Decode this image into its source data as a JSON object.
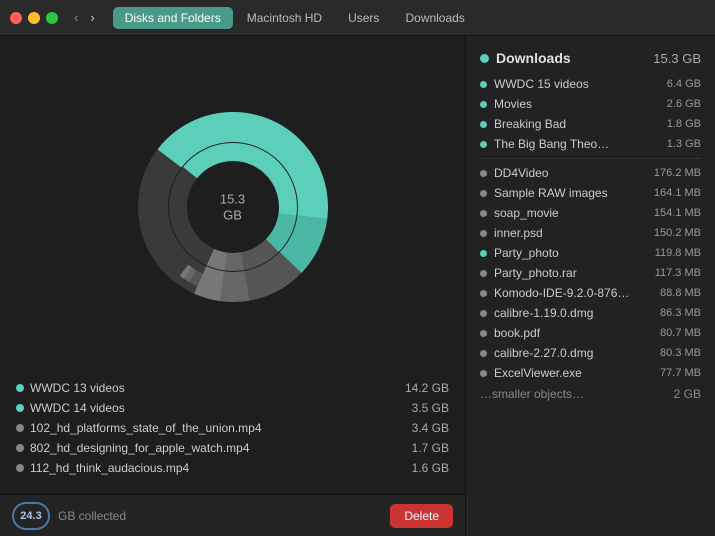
{
  "titlebar": {
    "tabs": [
      {
        "label": "Disks and Folders",
        "active": true
      },
      {
        "label": "Macintosh HD",
        "active": false
      },
      {
        "label": "Users",
        "active": false
      },
      {
        "label": "Downloads",
        "active": false
      }
    ]
  },
  "chart": {
    "center_value": "15.3",
    "center_unit": "GB"
  },
  "files": [
    {
      "name": "WWDC 13 videos",
      "size": "14.2 GB",
      "color": "#5bcfba",
      "active": true
    },
    {
      "name": "WWDC 14 videos",
      "size": "3.5 GB",
      "color": "#5bcfba",
      "active": true
    },
    {
      "name": "102_hd_platforms_state_of_the_union.mp4",
      "size": "3.4 GB",
      "color": "#888",
      "active": false
    },
    {
      "name": "802_hd_designing_for_apple_watch.mp4",
      "size": "1.7 GB",
      "color": "#888",
      "active": false
    },
    {
      "name": "112_hd_think_audacious.mp4",
      "size": "1.6 GB",
      "color": "#888",
      "active": false
    }
  ],
  "bottom": {
    "collected": "24.3",
    "label": "GB collected",
    "delete_btn": "Delete"
  },
  "right_panel": {
    "title": "Downloads",
    "total_size": "15.3 GB",
    "header_dot_color": "#5bcfba",
    "items": [
      {
        "name": "WWDC 15 videos",
        "size": "6.4 GB",
        "color": "#5bcfba",
        "large": true
      },
      {
        "name": "Movies",
        "size": "2.6 GB",
        "color": "#5bcfba",
        "large": true
      },
      {
        "name": "Breaking Bad",
        "size": "1.8 GB",
        "color": "#5bcfba",
        "large": true
      },
      {
        "name": "The Big Bang Theo…",
        "size": "1.3 GB",
        "color": "#5bcfba",
        "large": true
      },
      {
        "name": "DD4Video",
        "size": "176.2 MB",
        "color": "#888",
        "large": false
      },
      {
        "name": "Sample RAW images",
        "size": "164.1 MB",
        "color": "#888",
        "large": false
      },
      {
        "name": "soap_movie",
        "size": "154.1 MB",
        "color": "#888",
        "large": false
      },
      {
        "name": "inner.psd",
        "size": "150.2 MB",
        "color": "#888",
        "large": false
      },
      {
        "name": "Party_photo",
        "size": "119.8 MB",
        "color": "#5bcfba",
        "large": false
      },
      {
        "name": "Party_photo.rar",
        "size": "117.3 MB",
        "color": "#888",
        "large": false
      },
      {
        "name": "Komodo-IDE-9.2.0-876…",
        "size": "88.8 MB",
        "color": "#888",
        "large": false
      },
      {
        "name": "calibre-1.19.0.dmg",
        "size": "86.3 MB",
        "color": "#888",
        "large": false
      },
      {
        "name": "book.pdf",
        "size": "80.7 MB",
        "color": "#888",
        "large": false
      },
      {
        "name": "calibre-2.27.0.dmg",
        "size": "80.3 MB",
        "color": "#888",
        "large": false
      },
      {
        "name": "ExcelViewer.exe",
        "size": "77.7 MB",
        "color": "#888",
        "large": false
      }
    ],
    "ellipsis": "…smaller objects…",
    "ellipsis_size": "2 GB"
  }
}
